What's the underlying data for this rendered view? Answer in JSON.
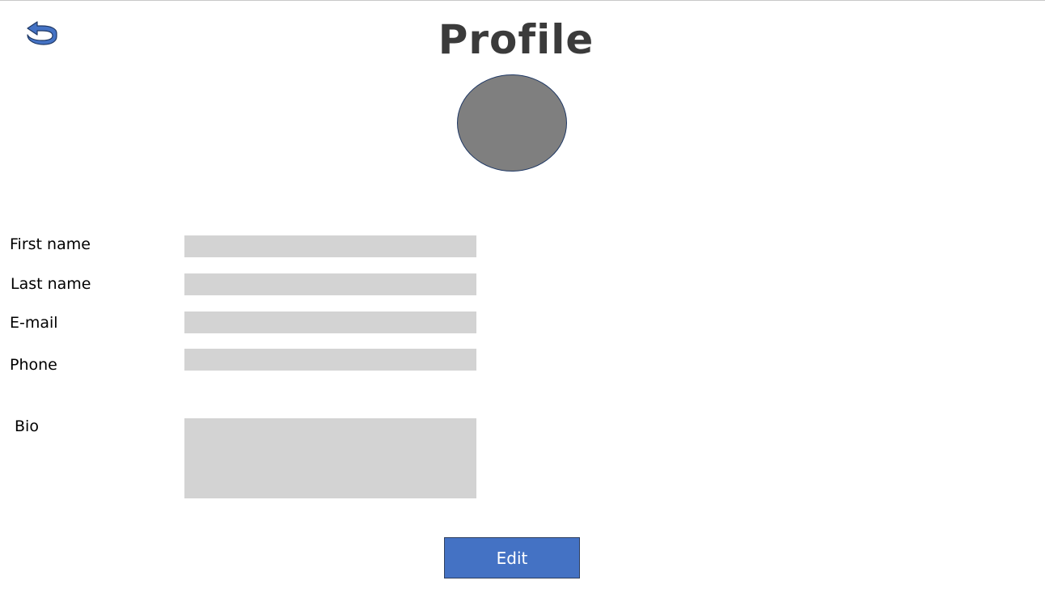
{
  "header": {
    "title": "Profile",
    "back_icon": "back-arrow-icon"
  },
  "avatar": {
    "fill_color": "#7f7f7f",
    "border_color": "#1f3864"
  },
  "form": {
    "first_name": {
      "label": "First name",
      "value": ""
    },
    "last_name": {
      "label": "Last name",
      "value": ""
    },
    "email": {
      "label": "E-mail",
      "value": ""
    },
    "phone": {
      "label": "Phone",
      "value": ""
    },
    "bio": {
      "label": "Bio",
      "value": ""
    }
  },
  "actions": {
    "edit_label": "Edit",
    "edit_color": "#4472c4"
  },
  "colors": {
    "input_background": "#d3d3d3",
    "title_color": "#3b3b3b",
    "back_icon_color": "#4472c4"
  }
}
